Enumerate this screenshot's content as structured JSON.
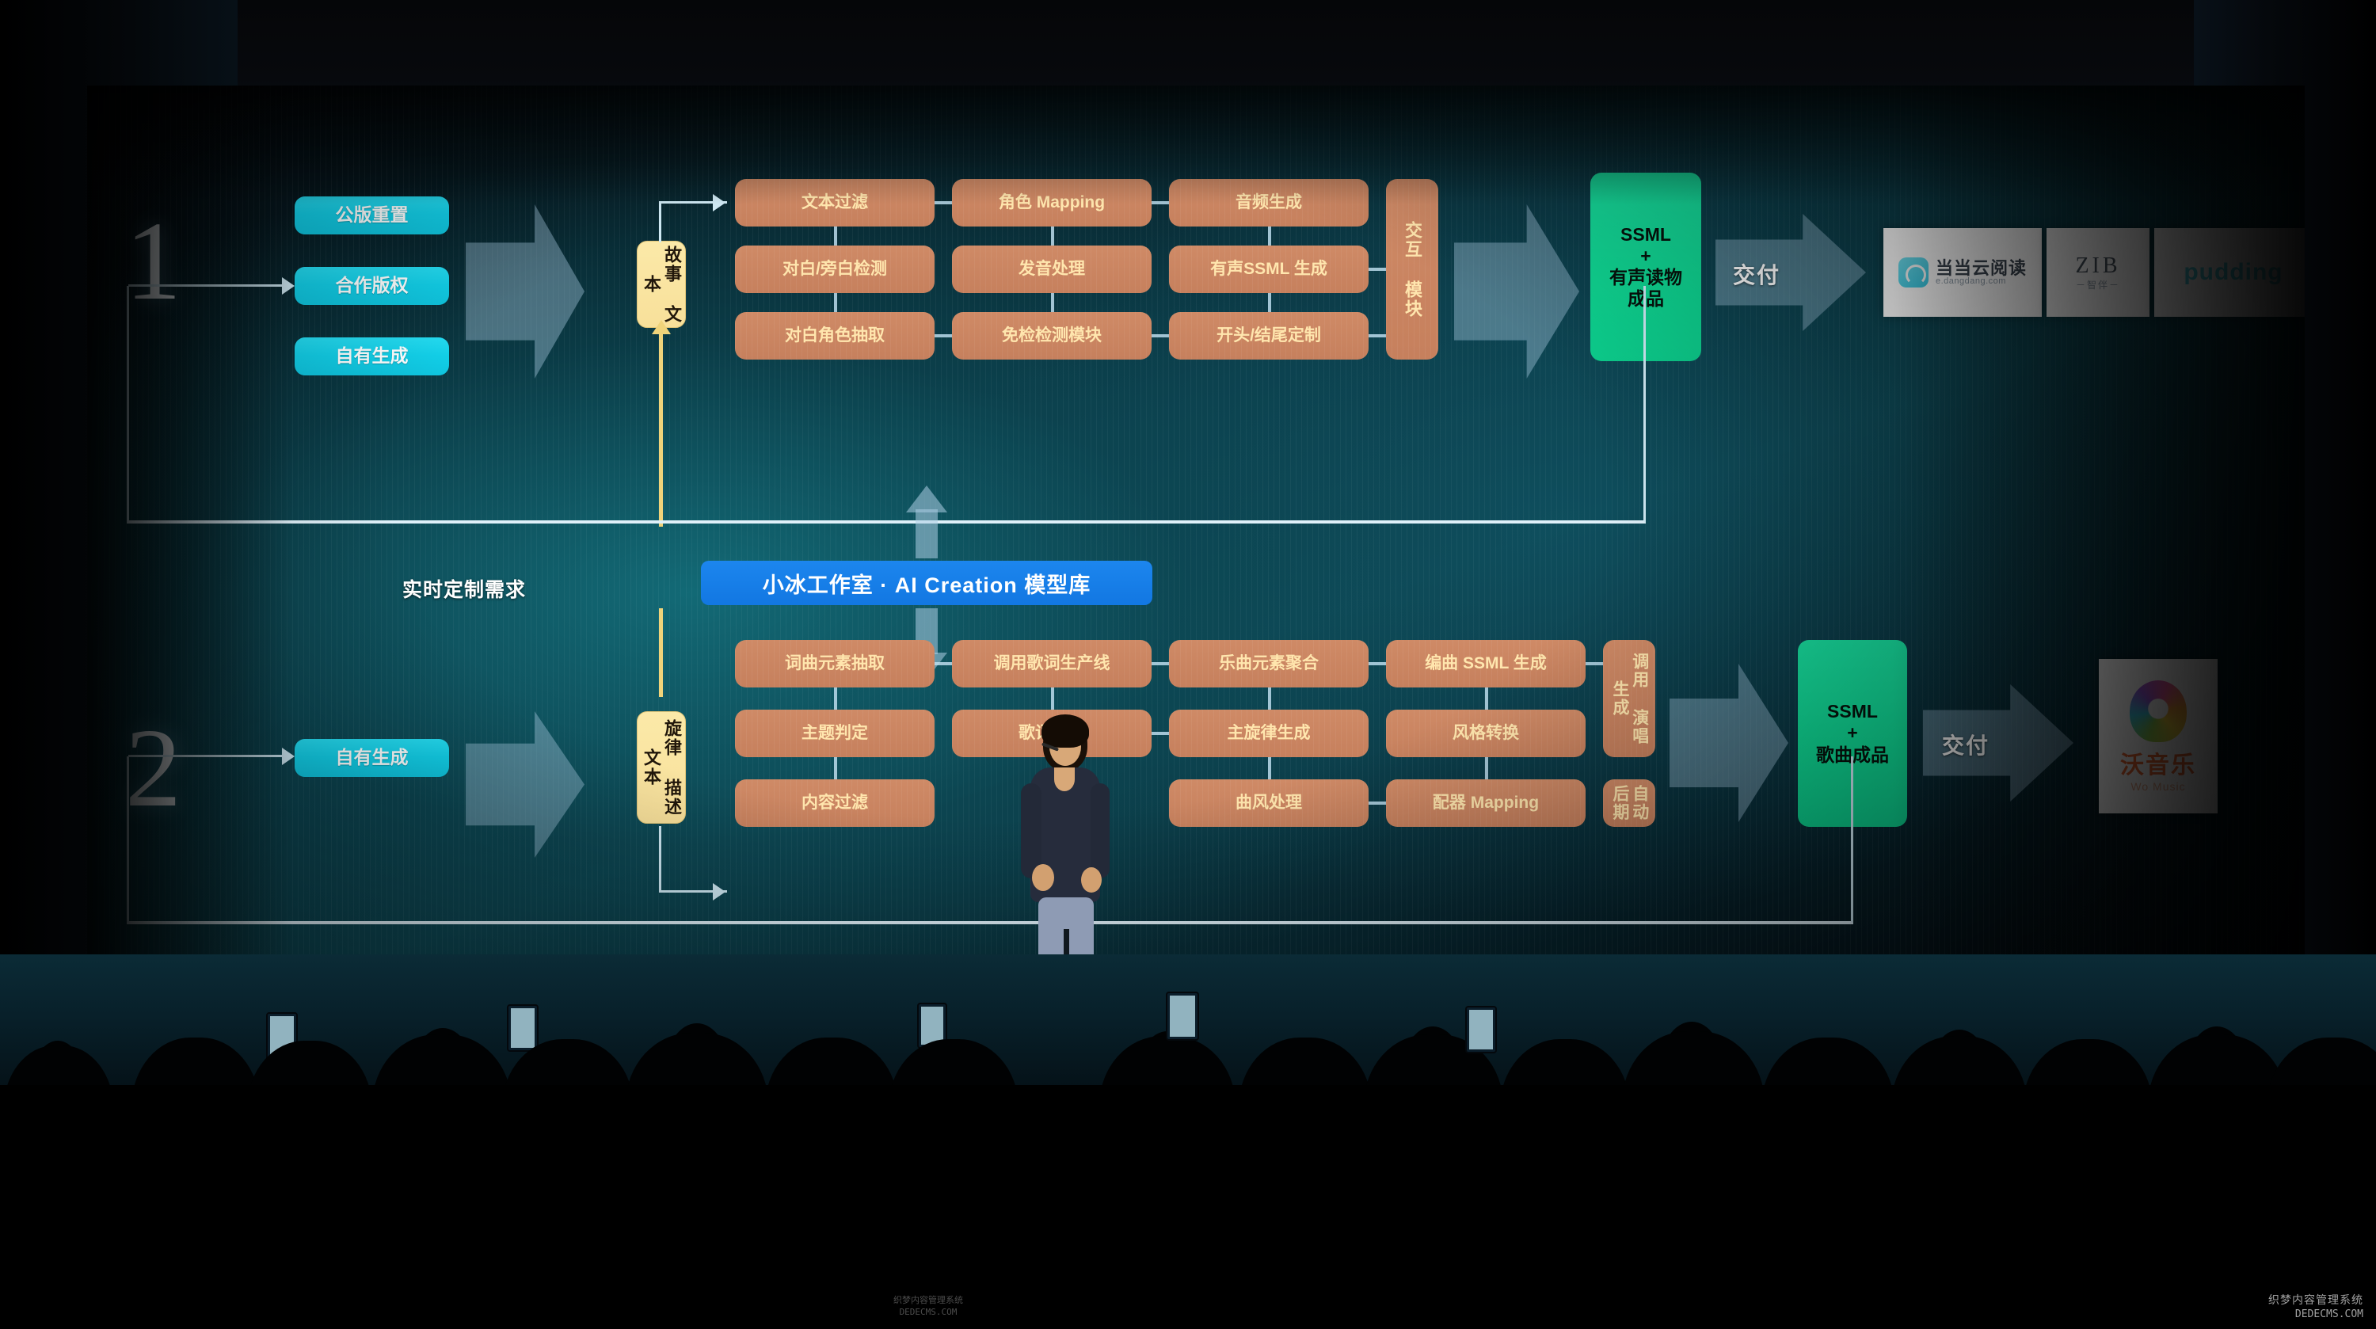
{
  "slide": {
    "center_banner": "小冰工作室 · AI Creation 模型库",
    "realtime_note": "实时定制需求"
  },
  "row1": {
    "number": "1",
    "sources": [
      "公版重置",
      "合作版权",
      "自有生成"
    ],
    "hub": "故事\n文本",
    "pipeline": [
      [
        "文本过滤",
        "角色 Mapping",
        "音频生成"
      ],
      [
        "对白/旁白检测",
        "发音处理",
        "有声SSML 生成"
      ],
      [
        "对白角色抽取",
        "免检检测模块",
        "开头/结尾定制"
      ]
    ],
    "side_module": "交互\n模块",
    "output": "SSML\n+\n有声读物\n成品",
    "deliver_label": "交付",
    "partners": [
      {
        "name": "当当云阅读",
        "sub": "e.dangdang.com"
      },
      {
        "name": "ZIB",
        "sub": "－智伴－"
      },
      {
        "name": "pudding",
        "sub": ""
      }
    ]
  },
  "row2": {
    "number": "2",
    "sources": [
      "自有生成"
    ],
    "hub": "旋律\n描述\n文本",
    "pipeline": [
      [
        "词曲元素抽取",
        "调用歌词生产线",
        "乐曲元素聚合",
        "编曲 SSML 生成"
      ],
      [
        "主题判定",
        "歌词生成",
        "主旋律生成",
        "风格转换"
      ],
      [
        "内容过滤",
        "",
        "曲风处理",
        "配器 Mapping"
      ]
    ],
    "side_modules": [
      "调用\n演唱\n生成",
      "自动\n后期"
    ],
    "output": "SSML\n+\n歌曲成品",
    "deliver_label": "交付",
    "partners": [
      {
        "name": "沃音乐",
        "sub": "Wo Music"
      }
    ]
  },
  "watermark": {
    "cn": "织梦内容管理系统",
    "en": "DEDECMS.COM",
    "center_cn": "织梦内容管理系统",
    "center_en": "DEDECMS.COM"
  },
  "colors": {
    "cyan": "#12cfe8",
    "orange": "#c8825f",
    "yellow": "#f8e09a",
    "green": "#0fd793",
    "banner_blue": "#1c86ee",
    "wire": "#cfe9f4"
  }
}
